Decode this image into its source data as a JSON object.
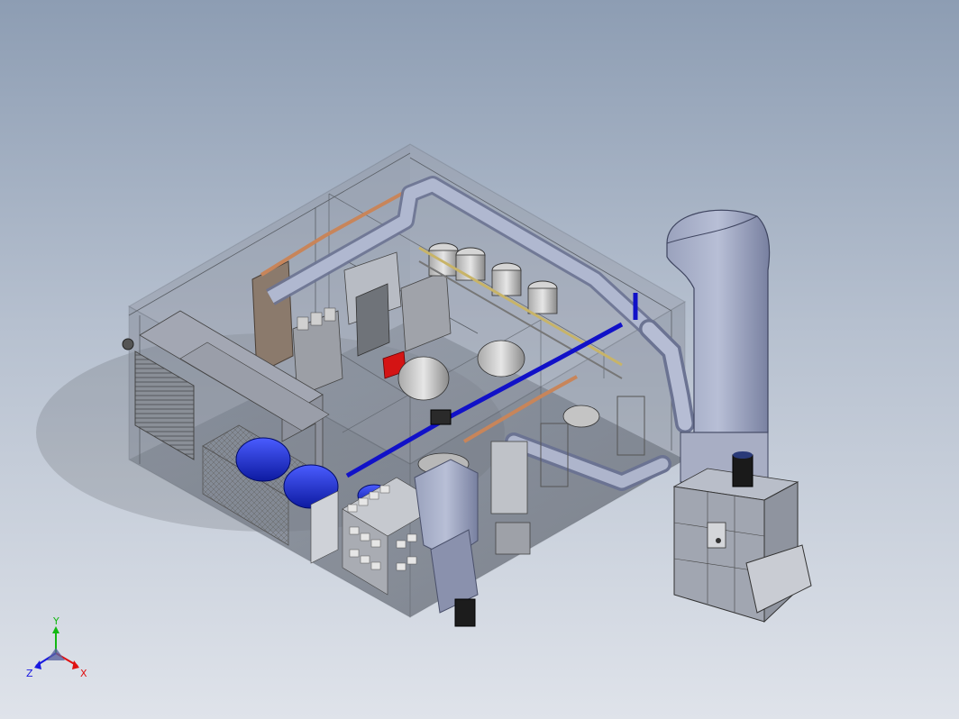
{
  "view": {
    "background_top": "#8d9db3",
    "background_bottom": "#dfe3ea"
  },
  "triad": {
    "y_label": "Y",
    "x_label": "X",
    "z_label": "Z",
    "y_color": "#12b812",
    "x_color": "#e01010",
    "z_color": "#1818e0"
  },
  "colors": {
    "enclosure_stroke": "#5a5f66",
    "duct": "#8a93b0",
    "duct_dark": "#6b7392",
    "pipe_blue": "#1111c8",
    "pipe_copper": "#c8855a",
    "drum_blue": "#1a2dd8",
    "frame_grey": "#7d8088",
    "red_part": "#d41414"
  }
}
